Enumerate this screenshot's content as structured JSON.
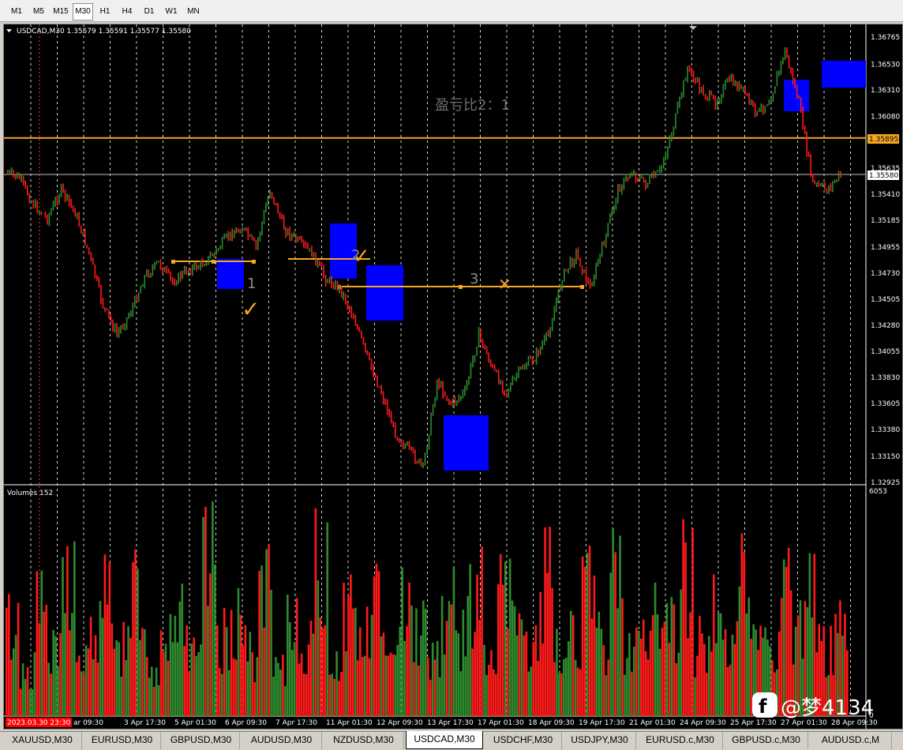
{
  "timeframes": [
    {
      "label": "M1",
      "active": false
    },
    {
      "label": "M5",
      "active": false
    },
    {
      "label": "M15",
      "active": false
    },
    {
      "label": "M30",
      "active": true
    },
    {
      "label": "H1",
      "active": false
    },
    {
      "label": "H4",
      "active": false
    },
    {
      "label": "D1",
      "active": false
    },
    {
      "label": "W1",
      "active": false
    },
    {
      "label": "MN",
      "active": false
    }
  ],
  "chart": {
    "symbol_info": "USDCAD,M30  1.35579 1.35591 1.35577 1.35580",
    "ratio_annotation": "盈亏比2：1",
    "zone_labels": [
      "1",
      "2",
      "3"
    ],
    "check_mark": "✓",
    "cross_mark": "✕",
    "current_price": "1.35580",
    "line_price": "1.35895",
    "volumes_label": "Volumes 152",
    "volume_axis_max": "6053",
    "volume_axis_min": "0",
    "watermark": "@梦4134",
    "start_datetime": "2023.03.30 23:30",
    "colors": {
      "background": "#000000",
      "bull_candle": "#2e8b2e",
      "bear_candle": "#ff1a1a",
      "grid": "#ffffff",
      "zone": "#0000ff",
      "level_line": "#f5a623",
      "current_price_line": "#c0c0c0"
    }
  },
  "price_axis": [
    "1.36765",
    "1.36530",
    "1.36310",
    "1.36080",
    "1.35635",
    "1.35410",
    "1.35185",
    "1.34955",
    "1.34730",
    "1.34505",
    "1.34280",
    "1.34055",
    "1.33830",
    "1.33605",
    "1.33380",
    "1.33150",
    "1.32925"
  ],
  "time_axis": [
    "ar 09:30",
    "3 Apr 17:30",
    "5 Apr 01:30",
    "6 Apr 09:30",
    "7 Apr 17:30",
    "11 Apr 01:30",
    "12 Apr 09:30",
    "13 Apr 17:30",
    "17 Apr 01:30",
    "18 Apr 09:30",
    "19 Apr 17:30",
    "21 Apr 01:30",
    "24 Apr 09:30",
    "25 Apr 17:30",
    "27 Apr 01:30",
    "28 Apr 09:30"
  ],
  "chart_data": {
    "type": "line",
    "symbol": "USDCAD",
    "timeframe": "M30",
    "series": [
      {
        "values": [
          1.356,
          1.3555,
          1.3532,
          1.352,
          1.3545,
          1.3525,
          1.349,
          1.3445,
          1.342,
          1.344,
          1.347,
          1.3482,
          1.3465,
          1.3475,
          1.348,
          1.349,
          1.3505,
          1.3512,
          1.3495,
          1.3545,
          1.3512,
          1.35,
          1.349,
          1.3468,
          1.346,
          1.3435,
          1.34,
          1.337,
          1.3335,
          1.332,
          1.3305,
          1.338,
          1.336,
          1.337,
          1.342,
          1.339,
          1.337,
          1.339,
          1.34,
          1.342,
          1.347,
          1.349,
          1.346,
          1.35,
          1.3545,
          1.356,
          1.355,
          1.356,
          1.36,
          1.365,
          1.363,
          1.362,
          1.364,
          1.363,
          1.361,
          1.3625,
          1.3665,
          1.362,
          1.355,
          1.3545,
          1.3558
        ]
      }
    ],
    "volume_series": [
      {
        "values": [
          3600,
          1800,
          4200,
          2400,
          5600,
          2100,
          3300,
          4800,
          2600,
          5100,
          1900,
          3700,
          4500,
          2200,
          5900,
          3000,
          4100,
          2500,
          4800,
          1700,
          3900,
          2800,
          5700,
          2300,
          4400,
          3100,
          4900,
          2000,
          5800,
          3500,
          2600,
          4200,
          3300,
          5000,
          2100,
          4600,
          3800,
          2700,
          5300,
          2400,
          3600,
          4700,
          2900,
          5500,
          3200,
          2800,
          4300,
          3600,
          5600,
          3000,
          4400,
          2500,
          5200,
          3700,
          2900,
          5400,
          3300,
          4800,
          2600,
          3900,
          1500
        ]
      }
    ],
    "ylim": [
      1.32925,
      1.36765
    ],
    "volume_ylim": [
      0,
      6053
    ],
    "grid": true
  }
}
